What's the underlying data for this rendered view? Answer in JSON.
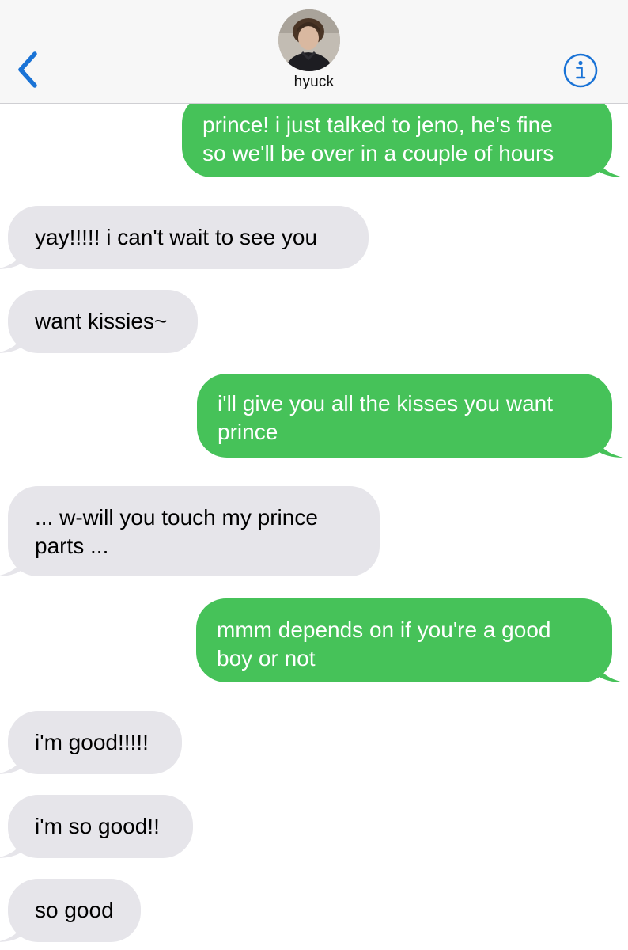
{
  "header": {
    "contact_name": "hyuck",
    "back_icon": "chevron-left-icon",
    "info_icon": "info-icon",
    "accent_color": "#1a73d6"
  },
  "colors": {
    "sent_bubble": "#46c259",
    "received_bubble": "#e6e5ea"
  },
  "messages": [
    {
      "from": "me",
      "text": "prince! i just talked to jeno, he's fine\nso we'll be over in a couple of hours"
    },
    {
      "from": "them",
      "text": "yay!!!!! i can't wait to see you"
    },
    {
      "from": "them",
      "text": "want kissies~"
    },
    {
      "from": "me",
      "text": "i'll give you all the kisses you want\nprince"
    },
    {
      "from": "them",
      "text": "... w-will you touch my prince\nparts ..."
    },
    {
      "from": "me",
      "text": "mmm depends on if you're a good\nboy or not"
    },
    {
      "from": "them",
      "text": "i'm good!!!!!"
    },
    {
      "from": "them",
      "text": "i'm so good!!"
    },
    {
      "from": "them",
      "text": "so good"
    }
  ]
}
